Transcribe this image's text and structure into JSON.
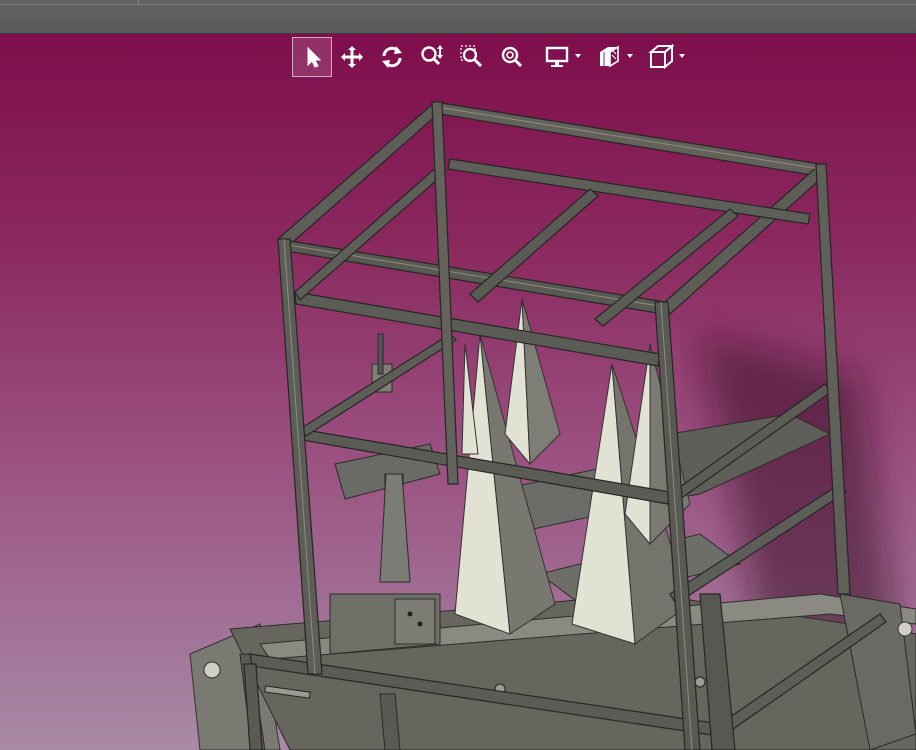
{
  "viewport": {
    "background_top": "#7e0e4c",
    "background_bottom": "#a88aa6",
    "toolbar": [
      {
        "name": "select-icon",
        "active": true
      },
      {
        "name": "pan-icon"
      },
      {
        "name": "rotate-icon"
      },
      {
        "name": "zoom-icon"
      },
      {
        "name": "zoom-window-icon"
      },
      {
        "name": "zoom-fit-icon"
      },
      {
        "name": "display-mode-icon",
        "dropdown": true
      },
      {
        "name": "section-view-icon",
        "dropdown": true
      },
      {
        "name": "view-cube-icon",
        "dropdown": true
      }
    ]
  },
  "model": {
    "frame_color": "#5c5c58",
    "cone_color": "#e2e2d4",
    "plate_color": "#6a6a66"
  }
}
